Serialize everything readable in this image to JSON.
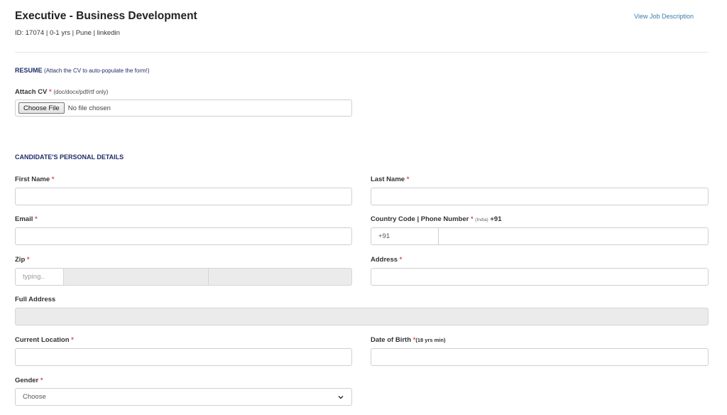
{
  "job": {
    "title": "Executive - Business Development",
    "meta": "ID: 17074 | 0-1 yrs | Pune | linkedin",
    "view_description": "View Job Description"
  },
  "resume": {
    "section_title": "RESUME",
    "section_subtitle": "(Attach the CV to auto-populate the form!)",
    "attach_label": "Attach CV",
    "required_mark": "*",
    "attach_note": "(doc/docx/pdf/rtf only)",
    "file_button": "Choose File",
    "file_status": "No file chosen"
  },
  "personal": {
    "section_title": "CANDIDATE'S PERSONAL DETAILS",
    "first_name_label": "First Name",
    "last_name_label": "Last Name",
    "email_label": "Email",
    "phone_label": "Country Code | Phone Number",
    "phone_country_hint": "(India)",
    "phone_code_display": "+91",
    "country_code_value": "+91",
    "zip_label": "Zip",
    "zip_placeholder": "typing..",
    "address_label": "Address",
    "full_address_label": "Full Address",
    "current_location_label": "Current Location",
    "dob_label": "Date of Birth",
    "dob_note": "(18 yrs min)",
    "gender_label": "Gender",
    "gender_value": "Choose",
    "required_mark": "*"
  },
  "colors": {
    "section_title": "#1f2d6b",
    "required": "#d9534f",
    "link": "#3a7ca5",
    "disabled_bg": "#ebebeb"
  },
  "icons": {
    "select_arrow": "chevron-down-icon"
  }
}
